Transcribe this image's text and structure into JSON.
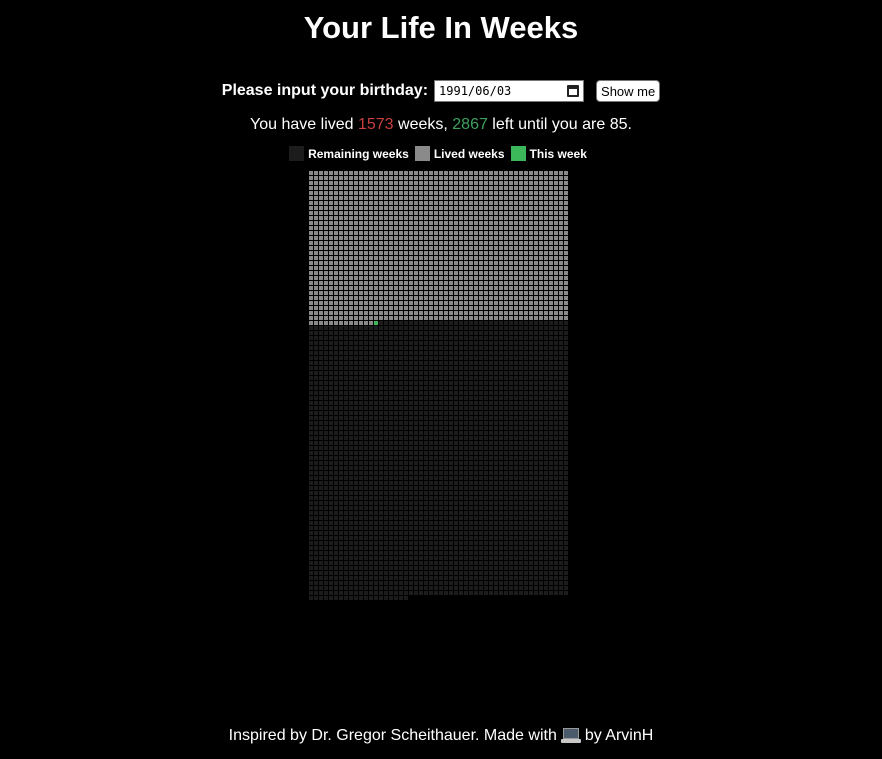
{
  "title": "Your Life In Weeks",
  "form": {
    "label": "Please input your birthday:",
    "birthday_value": "1991/06/03",
    "button_label": "Show me"
  },
  "summary": {
    "prefix": "You have lived ",
    "lived_weeks": "1573",
    "middle": " weeks, ",
    "remaining_weeks": "2867",
    "suffix": " left until you are 85."
  },
  "legend": {
    "remaining": {
      "label": "Remaining weeks",
      "color": "#1c1c1c"
    },
    "lived": {
      "label": "Lived weeks",
      "color": "#8a8a8a"
    },
    "current": {
      "label": "This week",
      "color": "#3cb85a"
    }
  },
  "grid": {
    "weeks_per_row": 52,
    "lived": 1573,
    "remaining": 2867,
    "colors": {
      "lived": "#8a8a8a",
      "remaining": "#1c1c1c",
      "current": "#3cb85a",
      "gap": "#000000"
    }
  },
  "footer": {
    "before": "Inspired by Dr. Gregor Scheithauer. Made with",
    "after": "by ArvinH",
    "icon": "laptop-icon"
  }
}
